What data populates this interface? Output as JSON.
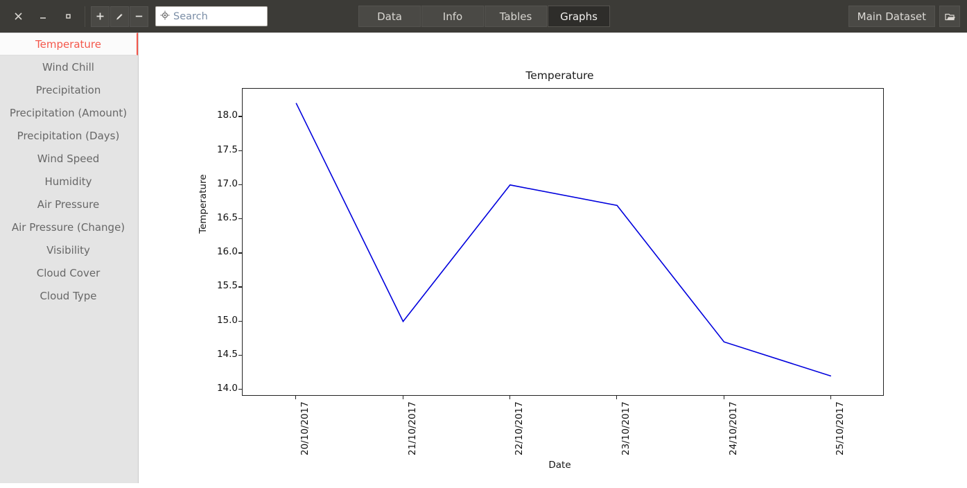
{
  "titlebar": {
    "window_controls": [
      {
        "name": "close",
        "glyph": "close-icon"
      },
      {
        "name": "minimize",
        "glyph": "minimize-icon"
      },
      {
        "name": "maximize",
        "glyph": "maximize-icon"
      }
    ],
    "tools": [
      {
        "name": "add",
        "label": "+"
      },
      {
        "name": "edit",
        "label": "pencil-icon"
      },
      {
        "name": "remove",
        "label": "−"
      }
    ],
    "search": {
      "placeholder": "Search",
      "value": "",
      "icon": "target-search-icon"
    },
    "tabs": [
      {
        "label": "Data",
        "active": false
      },
      {
        "label": "Info",
        "active": false
      },
      {
        "label": "Tables",
        "active": false
      },
      {
        "label": "Graphs",
        "active": true
      }
    ],
    "dataset_button": "Main Dataset",
    "dataset_icon": "folder-icon"
  },
  "sidebar": {
    "items": [
      {
        "label": "Temperature",
        "selected": true
      },
      {
        "label": "Wind Chill",
        "selected": false
      },
      {
        "label": "Precipitation",
        "selected": false
      },
      {
        "label": "Precipitation (Amount)",
        "selected": false
      },
      {
        "label": "Precipitation (Days)",
        "selected": false
      },
      {
        "label": "Wind Speed",
        "selected": false
      },
      {
        "label": "Humidity",
        "selected": false
      },
      {
        "label": "Air Pressure",
        "selected": false
      },
      {
        "label": "Air Pressure (Change)",
        "selected": false
      },
      {
        "label": "Visibility",
        "selected": false
      },
      {
        "label": "Cloud Cover",
        "selected": false
      },
      {
        "label": "Cloud Type",
        "selected": false
      }
    ]
  },
  "chart_data": {
    "type": "line",
    "title": "Temperature",
    "xlabel": "Date",
    "ylabel": "Temperature",
    "categories": [
      "20/10/2017",
      "21/10/2017",
      "22/10/2017",
      "23/10/2017",
      "24/10/2017",
      "25/10/2017"
    ],
    "values": [
      18.2,
      15.0,
      17.0,
      16.7,
      14.7,
      14.2
    ],
    "yticks": [
      14.0,
      14.5,
      15.0,
      15.5,
      16.0,
      16.5,
      17.0,
      17.5,
      18.0
    ],
    "ylim": [
      13.9,
      18.41
    ],
    "grid": false,
    "legend": null,
    "line_color": "#0000dd",
    "marker": "none"
  },
  "colors": {
    "titlebar_bg": "#3c3b37",
    "sidebar_bg": "#e4e4e4",
    "accent": "#f4574b",
    "line": "#0000dd"
  }
}
